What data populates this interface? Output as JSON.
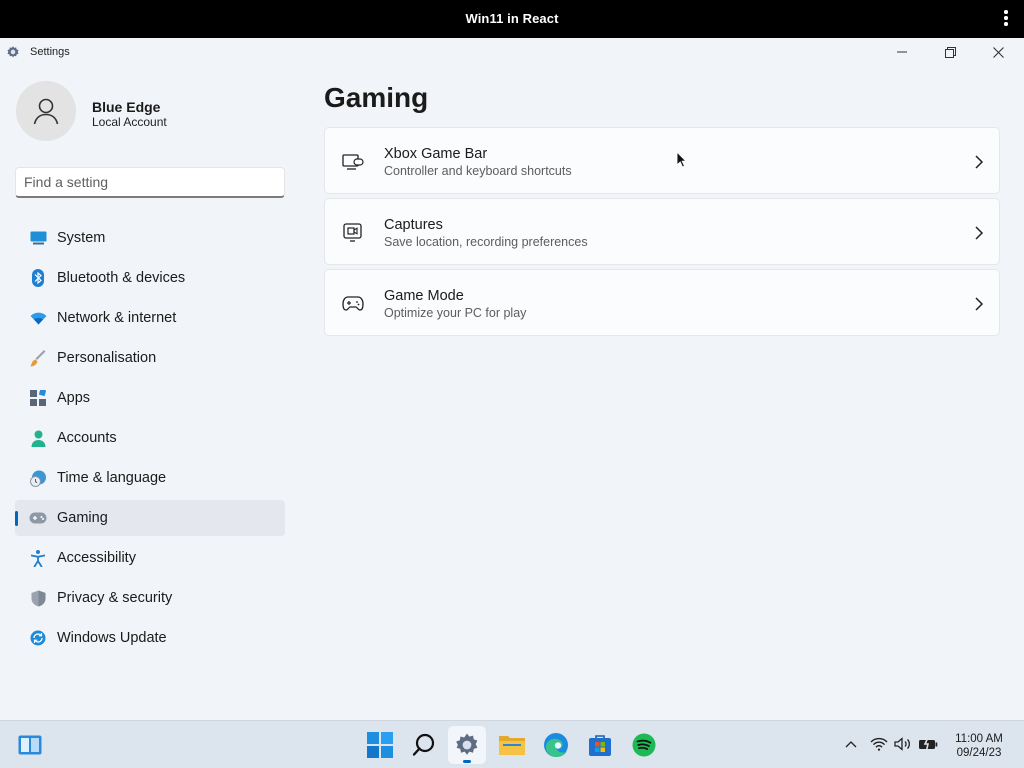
{
  "browser": {
    "title": "Win11 in React"
  },
  "window": {
    "title": "Settings"
  },
  "user": {
    "name": "Blue Edge",
    "account_type": "Local Account"
  },
  "search": {
    "placeholder": "Find a setting",
    "value": ""
  },
  "sidebar": {
    "items": [
      {
        "label": "System",
        "icon": "system-icon"
      },
      {
        "label": "Bluetooth & devices",
        "icon": "bluetooth-icon"
      },
      {
        "label": "Network & internet",
        "icon": "wifi-icon"
      },
      {
        "label": "Personalisation",
        "icon": "brush-icon"
      },
      {
        "label": "Apps",
        "icon": "apps-icon"
      },
      {
        "label": "Accounts",
        "icon": "person-icon"
      },
      {
        "label": "Time & language",
        "icon": "globe-clock-icon"
      },
      {
        "label": "Gaming",
        "icon": "gamepad-icon",
        "selected": true
      },
      {
        "label": "Accessibility",
        "icon": "accessibility-icon"
      },
      {
        "label": "Privacy & security",
        "icon": "shield-icon"
      },
      {
        "label": "Windows Update",
        "icon": "update-icon"
      }
    ]
  },
  "main": {
    "title": "Gaming",
    "cards": [
      {
        "title": "Xbox Game Bar",
        "subtitle": "Controller and keyboard shortcuts",
        "icon": "game-bar-icon"
      },
      {
        "title": "Captures",
        "subtitle": "Save location, recording preferences",
        "icon": "capture-icon"
      },
      {
        "title": "Game Mode",
        "subtitle": "Optimize your PC for play",
        "icon": "gamepad-icon"
      }
    ]
  },
  "taskbar": {
    "apps": [
      "widgets-icon",
      "start-icon",
      "search-icon",
      "settings-icon",
      "file-explorer-icon",
      "edge-icon",
      "store-icon",
      "spotify-icon"
    ],
    "active_app": "settings-icon",
    "clock": {
      "time": "11:00 AM",
      "date": "09/24/23"
    }
  },
  "colors": {
    "accent": "#0067c0",
    "spotify": "#1db954",
    "explorer": "#f6c244"
  }
}
